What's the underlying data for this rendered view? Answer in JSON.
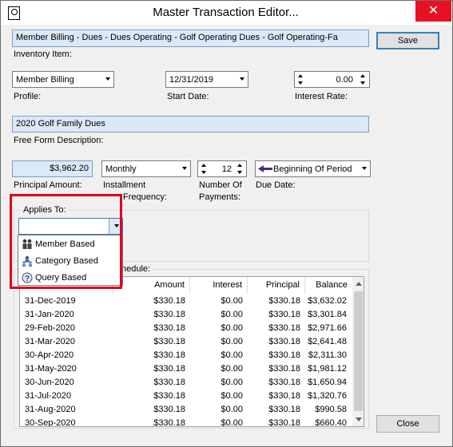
{
  "window": {
    "title": "Master Transaction Editor...",
    "close_glyph": "✕"
  },
  "inventory": {
    "value": "Member Billing - Dues - Dues Operating - Golf Operating Dues - Golf Operating-Fa",
    "label": "Inventory Item:"
  },
  "buttons": {
    "save": "Save",
    "close": "Close"
  },
  "profile": {
    "value": "Member Billing",
    "label": "Profile:"
  },
  "start_date": {
    "value": "12/31/2019",
    "label": "Start Date:"
  },
  "interest_rate": {
    "value": "0.00",
    "label": "Interest Rate:"
  },
  "description": {
    "value": "2020 Golf Family Dues",
    "label": "Free Form Description:"
  },
  "principal": {
    "value": "$3,962.20",
    "label": "Principal Amount:"
  },
  "frequency": {
    "value": "Monthly",
    "label_line1": "Installment",
    "label_line2": "Frequency:"
  },
  "payments": {
    "value": "12",
    "label_line1": "Number Of",
    "label_line2": "Payments:"
  },
  "due_date": {
    "value": "Beginning Of Period",
    "label": "Due Date:",
    "icon": "arrow-left-icon"
  },
  "applies_to": {
    "label": "Applies To:",
    "value": "",
    "options": [
      {
        "label": "Member Based",
        "icon": "members-icon"
      },
      {
        "label": "Category Based",
        "icon": "category-icon"
      },
      {
        "label": "Query Based",
        "icon": "query-icon"
      }
    ]
  },
  "schedule": {
    "label": "hedule:",
    "columns": [
      "Amount",
      "Interest",
      "Principal",
      "Balance"
    ],
    "rows": [
      [
        "31-Dec-2019",
        "$330.18",
        "$0.00",
        "$330.18",
        "$3,632.02"
      ],
      [
        "31-Jan-2020",
        "$330.18",
        "$0.00",
        "$330.18",
        "$3,301.84"
      ],
      [
        "29-Feb-2020",
        "$330.18",
        "$0.00",
        "$330.18",
        "$2,971.66"
      ],
      [
        "31-Mar-2020",
        "$330.18",
        "$0.00",
        "$330.18",
        "$2,641.48"
      ],
      [
        "30-Apr-2020",
        "$330.18",
        "$0.00",
        "$330.18",
        "$2,311.30"
      ],
      [
        "31-May-2020",
        "$330.18",
        "$0.00",
        "$330.18",
        "$1,981.12"
      ],
      [
        "30-Jun-2020",
        "$330.18",
        "$0.00",
        "$330.18",
        "$1,650.94"
      ],
      [
        "31-Jul-2020",
        "$330.18",
        "$0.00",
        "$330.18",
        "$1,320.76"
      ],
      [
        "31-Aug-2020",
        "$330.18",
        "$0.00",
        "$330.18",
        "$990.58"
      ],
      [
        "30-Sep-2020",
        "$330.18",
        "$0.00",
        "$330.18",
        "$660.40"
      ]
    ]
  },
  "colors": {
    "highlight": "#e0001b",
    "close_button": "#e81123",
    "field_blue": "#dbe8f6"
  }
}
